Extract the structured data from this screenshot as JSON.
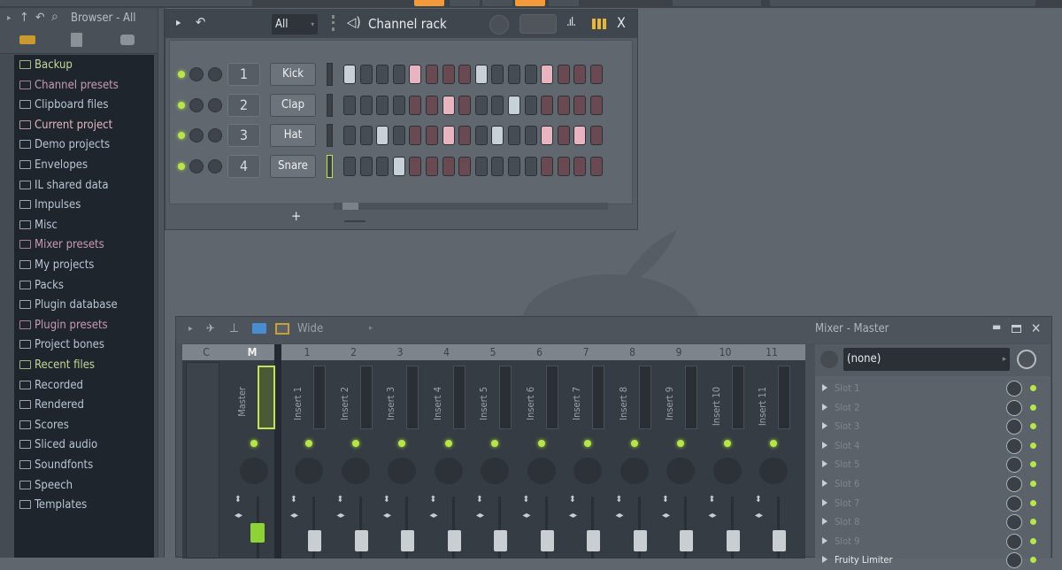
{
  "browser": {
    "title": "Browser - All",
    "items": [
      {
        "label": "Backup",
        "color": "#c9d69a"
      },
      {
        "label": "Channel presets",
        "color": "#c99ab3"
      },
      {
        "label": "Clipboard files",
        "color": "#b9c6d2"
      },
      {
        "label": "Current project",
        "color": "#e3b7be"
      },
      {
        "label": "Demo projects",
        "color": "#b9c6d2"
      },
      {
        "label": "Envelopes",
        "color": "#b9c6d2"
      },
      {
        "label": "IL shared data",
        "color": "#b9c6d2"
      },
      {
        "label": "Impulses",
        "color": "#b9c6d2"
      },
      {
        "label": "Misc",
        "color": "#b9c6d2"
      },
      {
        "label": "Mixer presets",
        "color": "#c99ab3"
      },
      {
        "label": "My projects",
        "color": "#b9c6d2"
      },
      {
        "label": "Packs",
        "color": "#b9c6d2"
      },
      {
        "label": "Plugin database",
        "color": "#b9c6d2"
      },
      {
        "label": "Plugin presets",
        "color": "#c99ab3"
      },
      {
        "label": "Project bones",
        "color": "#b9c6d2"
      },
      {
        "label": "Recent files",
        "color": "#c9d69a"
      },
      {
        "label": "Recorded",
        "color": "#b9c6d2"
      },
      {
        "label": "Rendered",
        "color": "#b9c6d2"
      },
      {
        "label": "Scores",
        "color": "#b9c6d2"
      },
      {
        "label": "Sliced audio",
        "color": "#b9c6d2"
      },
      {
        "label": "Soundfonts",
        "color": "#b9c6d2"
      },
      {
        "label": "Speech",
        "color": "#b9c6d2"
      },
      {
        "label": "Templates",
        "color": "#b9c6d2"
      }
    ]
  },
  "channel_rack": {
    "title": "Channel rack",
    "filter": "All",
    "add_label": "+",
    "close_label": "X",
    "channels": [
      {
        "number": "1",
        "name": "Kick",
        "steps": [
          1,
          0,
          0,
          0,
          1,
          0,
          0,
          0,
          1,
          0,
          0,
          0,
          1,
          0,
          0,
          0
        ]
      },
      {
        "number": "2",
        "name": "Clap",
        "steps": [
          0,
          0,
          0,
          0,
          0,
          0,
          1,
          0,
          0,
          0,
          1,
          0,
          0,
          0,
          0,
          0
        ]
      },
      {
        "number": "3",
        "name": "Hat",
        "steps": [
          0,
          0,
          1,
          0,
          0,
          0,
          1,
          0,
          0,
          1,
          0,
          0,
          1,
          0,
          1,
          0
        ]
      },
      {
        "number": "4",
        "name": "Snare",
        "steps": [
          0,
          0,
          0,
          1,
          0,
          0,
          0,
          0,
          0,
          0,
          0,
          0,
          0,
          0,
          0,
          0
        ]
      }
    ]
  },
  "mixer": {
    "title": "Mixer - Master",
    "layout": "Wide",
    "headers": [
      "C",
      "M",
      "1",
      "2",
      "3",
      "4",
      "5",
      "6",
      "7",
      "8",
      "9",
      "10",
      "11"
    ],
    "master_label": "Master",
    "inserts": [
      "Insert 1",
      "Insert 2",
      "Insert 3",
      "Insert 4",
      "Insert 5",
      "Insert 6",
      "Insert 7",
      "Insert 8",
      "Insert 9",
      "Insert 10",
      "Insert 11"
    ],
    "input": "(none)",
    "slots": [
      "Slot 1",
      "Slot 2",
      "Slot 3",
      "Slot 4",
      "Slot 5",
      "Slot 6",
      "Slot 7",
      "Slot 8",
      "Slot 9",
      "Fruity Limiter"
    ]
  },
  "colors": {
    "accent": "#f39a3a",
    "led": "#b6e64a",
    "master_fader": "#8fd236"
  }
}
